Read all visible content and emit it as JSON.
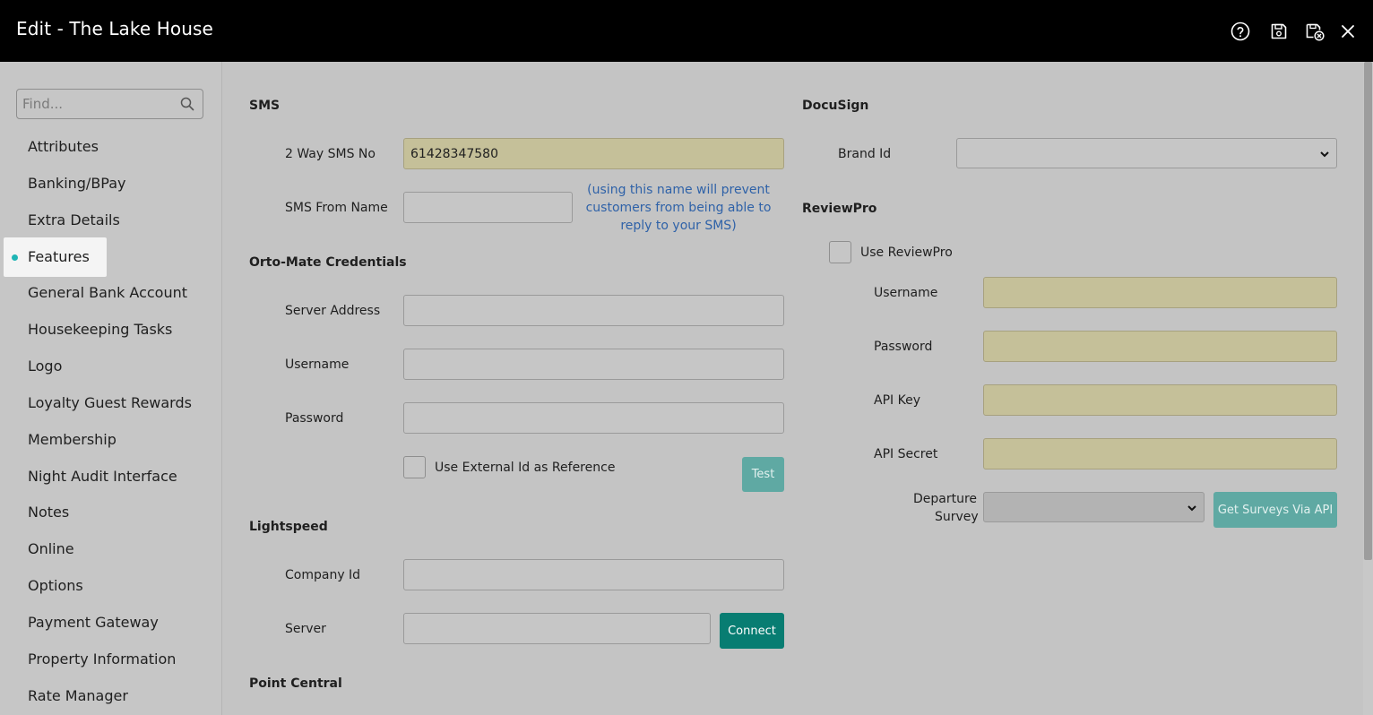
{
  "window": {
    "title": "Edit - The Lake House",
    "icons": [
      "help-circle-icon",
      "save-icon",
      "save-close-icon",
      "close-icon"
    ]
  },
  "sidebar": {
    "search_placeholder": "Find...",
    "active_item": "Features",
    "items": [
      {
        "label": "Attributes"
      },
      {
        "label": "Banking/BPay"
      },
      {
        "label": "Extra Details"
      },
      {
        "label": "Features"
      },
      {
        "label": "General Bank Account"
      },
      {
        "label": "Housekeeping Tasks"
      },
      {
        "label": "Logo"
      },
      {
        "label": "Loyalty Guest Rewards"
      },
      {
        "label": "Membership"
      },
      {
        "label": "Night Audit Interface"
      },
      {
        "label": "Notes"
      },
      {
        "label": "Online"
      },
      {
        "label": "Options"
      },
      {
        "label": "Payment Gateway"
      },
      {
        "label": "Property Information"
      },
      {
        "label": "Rate Manager"
      }
    ]
  },
  "sms": {
    "title": "SMS",
    "two_way_label": "2 Way SMS No",
    "two_way_value": "61428347580",
    "from_name_label": "SMS From Name",
    "from_name_value": "",
    "from_name_hint": "(using this name will prevent customers from being able to reply to your SMS)"
  },
  "ortomate": {
    "title": "Orto-Mate Credentials",
    "server_label": "Server Address",
    "server_value": "",
    "username_label": "Username",
    "username_value": "",
    "password_label": "Password",
    "password_value": "",
    "external_id_label": "Use External Id as Reference",
    "external_id_checked": false,
    "test_label": "Test"
  },
  "lightspeed": {
    "title": "Lightspeed",
    "company_label": "Company Id",
    "company_value": "",
    "server_label": "Server",
    "server_value": "",
    "connect_label": "Connect"
  },
  "pointcentral": {
    "title": "Point Central"
  },
  "docusign": {
    "title": "DocuSign",
    "brand_label": "Brand Id",
    "brand_value": ""
  },
  "reviewpro": {
    "title": "ReviewPro",
    "use_label": "Use ReviewPro",
    "use_checked": false,
    "username_label": "Username",
    "username_value": "",
    "password_label": "Password",
    "password_value": "",
    "apikey_label": "API Key",
    "apikey_value": "",
    "apisecret_label": "API Secret",
    "apisecret_value": "",
    "departure_label_1": "Departure",
    "departure_label_2": "Survey",
    "departure_value": "",
    "get_surveys_label": "Get Surveys Via API"
  },
  "colors": {
    "titlebar": "#000000",
    "accent_teal": "#087d72",
    "accent_teal_light": "#5fa9a3",
    "required_field": "#c5c099",
    "active_dot": "#1fb5b5",
    "hint_text": "#2f62a8"
  }
}
